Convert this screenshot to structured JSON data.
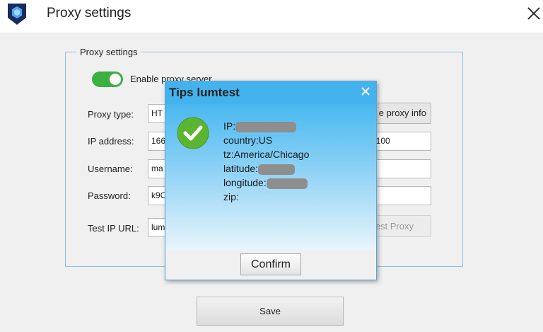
{
  "window": {
    "title": "Proxy settings",
    "icon": "app-logo-icon",
    "close_icon": "close-icon"
  },
  "group": {
    "legend": "Proxy settings",
    "enable_proxy": {
      "label": "Enable proxy server",
      "checked": true
    },
    "proxy_type": {
      "label": "Proxy type:",
      "value": "HT"
    },
    "ip_address": {
      "label": "IP address:",
      "value": "166",
      "port_value": "0100"
    },
    "username": {
      "label": "Username:",
      "value": "ma"
    },
    "password": {
      "label": "Password:",
      "value": "k9C"
    },
    "test_ip_url": {
      "label": "Test IP URL:",
      "value": "lum"
    },
    "proxy_info_button": "e proxy info",
    "test_proxy_button": "est Proxy"
  },
  "save_button": "Save",
  "dialog": {
    "title": "Tips lumtest",
    "ip_label": "IP:",
    "country": "country:US",
    "tz": "tz:America/Chicago",
    "latitude_label": "latitude:",
    "longitude_label": "longitude:",
    "zip_label": "zip:",
    "confirm_button": "Confirm"
  },
  "colors": {
    "toggle_on": "#3cb043",
    "dialog_header": "#44b2ec",
    "success_check": "#5cb531"
  }
}
